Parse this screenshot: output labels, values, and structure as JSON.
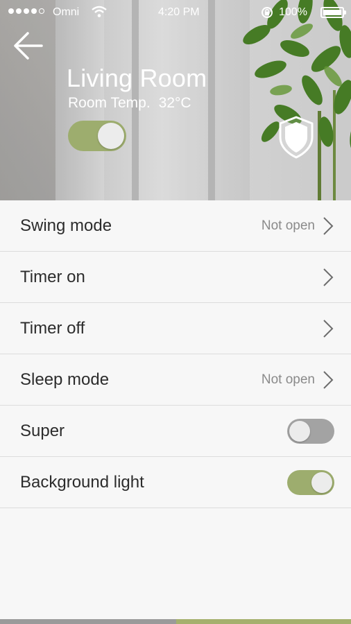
{
  "status_bar": {
    "carrier": "Omni",
    "time": "4:20 PM",
    "battery": "100%"
  },
  "header": {
    "title": "Living Room",
    "temp_label": "Room Temp.",
    "temp_value": "32°C",
    "power_on": true
  },
  "settings": [
    {
      "label": "Swing mode",
      "value": "Not open",
      "control": "chevron"
    },
    {
      "label": "Timer on",
      "value": "",
      "control": "chevron"
    },
    {
      "label": "Timer off",
      "value": "",
      "control": "chevron"
    },
    {
      "label": "Sleep mode",
      "value": "Not open",
      "control": "chevron"
    },
    {
      "label": "Super",
      "control": "toggle",
      "on": false
    },
    {
      "label": "Background light",
      "control": "toggle",
      "on": true
    }
  ],
  "colors": {
    "accent_green": "#9dad6e",
    "toggle_off": "#a3a3a3"
  }
}
